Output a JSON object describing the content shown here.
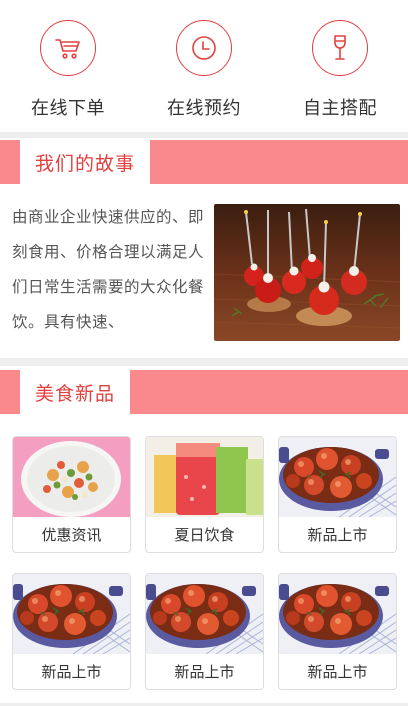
{
  "quick_nav": [
    {
      "label": "在线下单",
      "icon": "cart-icon"
    },
    {
      "label": "在线预约",
      "icon": "clock-icon"
    },
    {
      "label": "自主搭配",
      "icon": "wine-glass-icon"
    }
  ],
  "sections": {
    "story_title": "我们的故事",
    "food_title": "美食新品"
  },
  "story": {
    "text": "由商业企业快速供应的、即刻食用、价格合理以满足人们日常生活需要的大众化餐饮。具有快速、"
  },
  "products": [
    {
      "label": "优惠资讯",
      "image": "salad-plate"
    },
    {
      "label": "夏日饮食",
      "image": "juice-cups"
    },
    {
      "label": "新品上市",
      "image": "tomato-stew-pan"
    },
    {
      "label": "新品上市",
      "image": "tomato-stew-pan"
    },
    {
      "label": "新品上市",
      "image": "tomato-stew-pan"
    },
    {
      "label": "新品上市",
      "image": "tomato-stew-pan"
    }
  ],
  "colors": {
    "accent": "#e2403f",
    "section_bar": "#f9898c",
    "divider": "#eeeeee"
  }
}
